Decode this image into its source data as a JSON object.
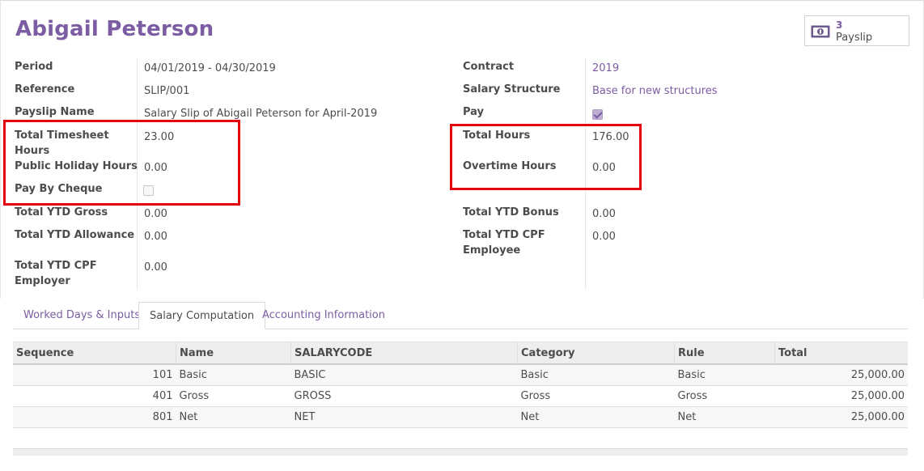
{
  "employee_name": "Abigail Peterson",
  "smart_button": {
    "count": "3",
    "label": "Payslip",
    "icon": "money-icon"
  },
  "left_fields": {
    "period": {
      "label": "Period",
      "value": "04/01/2019 - 04/30/2019"
    },
    "reference": {
      "label": "Reference",
      "value": "SLIP/001"
    },
    "payslip_name": {
      "label": "Payslip Name",
      "value": "Salary Slip of Abigail Peterson for April-2019"
    },
    "total_timesheet_hours": {
      "label_line1": "Total Timesheet",
      "label_line2": "Hours",
      "value": "23.00"
    },
    "public_holiday_hours": {
      "label": "Public Holiday Hours",
      "value": "0.00"
    },
    "pay_by_cheque": {
      "label": "Pay By Cheque",
      "checked": false
    },
    "total_ytd_gross": {
      "label": "Total YTD Gross",
      "value": "0.00"
    },
    "total_ytd_allowance": {
      "label": "Total YTD Allowance",
      "value": "0.00"
    },
    "total_ytd_cpf_employer": {
      "label_line1": "Total YTD CPF",
      "label_line2": "Employer",
      "value": "0.00"
    }
  },
  "right_fields": {
    "contract": {
      "label": "Contract",
      "value": "2019"
    },
    "salary_structure": {
      "label": "Salary Structure",
      "value": "Base for new structures"
    },
    "pay": {
      "label": "Pay",
      "checked": true
    },
    "total_hours": {
      "label": "Total Hours",
      "value": "176.00"
    },
    "overtime_hours": {
      "label": "Overtime Hours",
      "value": "0.00"
    },
    "total_ytd_bonus": {
      "label": "Total YTD Bonus",
      "value": "0.00"
    },
    "total_ytd_cpf_employee": {
      "label_line1": "Total YTD CPF",
      "label_line2": "Employee",
      "value": "0.00"
    }
  },
  "tabs": [
    {
      "label": "Worked Days & Inputs",
      "active": false
    },
    {
      "label": "Salary Computation",
      "active": true
    },
    {
      "label": "Accounting Information",
      "active": false
    }
  ],
  "table": {
    "headers": [
      "Sequence",
      "Name",
      "SALARYCODE",
      "Category",
      "Rule",
      "Total"
    ],
    "rows": [
      [
        "101",
        "Basic",
        "BASIC",
        "Basic",
        "Basic",
        "25,000.00"
      ],
      [
        "401",
        "Gross",
        "GROSS",
        "Gross",
        "Gross",
        "25,000.00"
      ],
      [
        "801",
        "Net",
        "NET",
        "Net",
        "Net",
        "25,000.00"
      ]
    ]
  },
  "colors": {
    "brand": "#7c5ca3",
    "highlight": "#e5000b",
    "text": "#4c4c4c"
  }
}
